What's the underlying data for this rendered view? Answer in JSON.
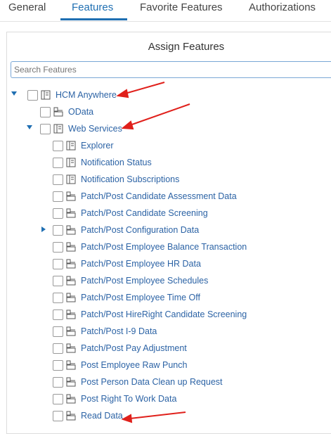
{
  "tabs": [
    {
      "label": "General",
      "active": false
    },
    {
      "label": "Features",
      "active": true
    },
    {
      "label": "Favorite Features",
      "active": false
    },
    {
      "label": "Authorizations",
      "active": false
    }
  ],
  "panel": {
    "title": "Assign Features",
    "search_placeholder": "Search Features"
  },
  "tree": [
    {
      "label": "HCM Anywhere",
      "level": 0,
      "expander": "expanded",
      "icon": "book-icon"
    },
    {
      "label": "OData",
      "level": 1,
      "expander": "none",
      "icon": "group-icon"
    },
    {
      "label": "Web Services",
      "level": 1,
      "expander": "expanded",
      "icon": "book-icon"
    },
    {
      "label": "Explorer",
      "level": 2,
      "expander": "none",
      "icon": "book-icon"
    },
    {
      "label": "Notification Status",
      "level": 2,
      "expander": "none",
      "icon": "book-icon"
    },
    {
      "label": "Notification Subscriptions",
      "level": 2,
      "expander": "none",
      "icon": "book-icon"
    },
    {
      "label": "Patch/Post Candidate Assessment Data",
      "level": 2,
      "expander": "none",
      "icon": "group-icon"
    },
    {
      "label": "Patch/Post Candidate Screening",
      "level": 2,
      "expander": "none",
      "icon": "group-icon"
    },
    {
      "label": "Patch/Post Configuration Data",
      "level": 2,
      "expander": "collapsed",
      "icon": "group-icon"
    },
    {
      "label": "Patch/Post Employee Balance Transaction",
      "level": 2,
      "expander": "none",
      "icon": "group-icon"
    },
    {
      "label": "Patch/Post Employee HR Data",
      "level": 2,
      "expander": "none",
      "icon": "group-icon"
    },
    {
      "label": "Patch/Post Employee Schedules",
      "level": 2,
      "expander": "none",
      "icon": "group-icon"
    },
    {
      "label": "Patch/Post Employee Time Off",
      "level": 2,
      "expander": "none",
      "icon": "group-icon"
    },
    {
      "label": "Patch/Post HireRight Candidate Screening",
      "level": 2,
      "expander": "none",
      "icon": "group-icon"
    },
    {
      "label": "Patch/Post I-9 Data",
      "level": 2,
      "expander": "none",
      "icon": "group-icon"
    },
    {
      "label": "Patch/Post Pay Adjustment",
      "level": 2,
      "expander": "none",
      "icon": "group-icon"
    },
    {
      "label": "Post Employee Raw Punch",
      "level": 2,
      "expander": "none",
      "icon": "group-icon"
    },
    {
      "label": "Post Person Data Clean up Request",
      "level": 2,
      "expander": "none",
      "icon": "group-icon"
    },
    {
      "label": "Post Right To Work Data",
      "level": 2,
      "expander": "none",
      "icon": "group-icon"
    },
    {
      "label": "Read Data",
      "level": 2,
      "expander": "none",
      "icon": "group-icon"
    }
  ],
  "colors": {
    "accent": "#1f6fb2",
    "link": "#2c63a5",
    "annotation": "#e0201b"
  }
}
